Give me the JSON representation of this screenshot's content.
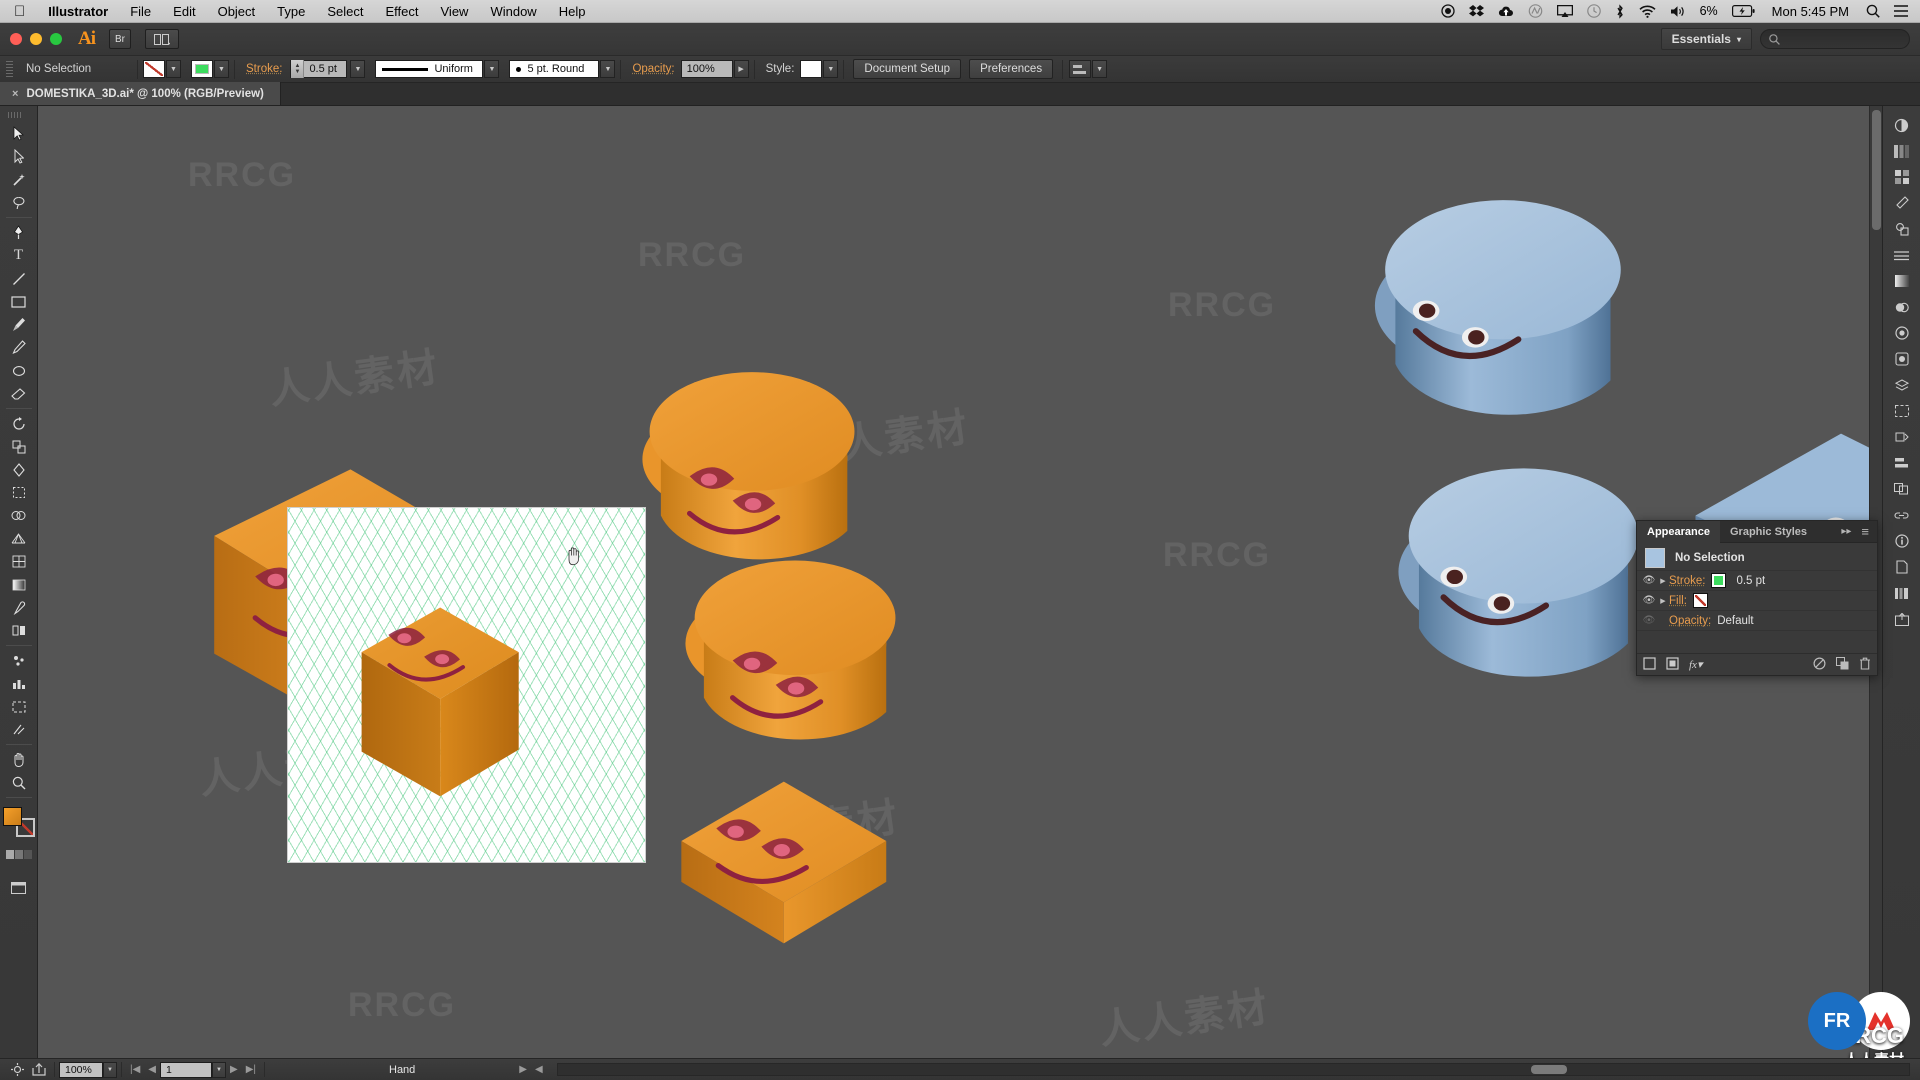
{
  "macmenu": {
    "apple_icon": "apple-icon",
    "items": [
      {
        "label": "Illustrator",
        "bold": true
      },
      {
        "label": "File",
        "bold": false
      },
      {
        "label": "Edit",
        "bold": false
      },
      {
        "label": "Object",
        "bold": false
      },
      {
        "label": "Type",
        "bold": false
      },
      {
        "label": "Select",
        "bold": false
      },
      {
        "label": "Effect",
        "bold": false
      },
      {
        "label": "View",
        "bold": false
      },
      {
        "label": "Window",
        "bold": false
      },
      {
        "label": "Help",
        "bold": false
      }
    ],
    "status_icons": [
      "record-icon",
      "dropbox-icon",
      "cloud-upload-icon",
      "creative-cloud-icon",
      "airplay-icon",
      "clock-icon",
      "bluetooth-icon",
      "wifi-icon",
      "volume-icon"
    ],
    "battery_percent": "6%",
    "battery_icon": "battery-charging-icon",
    "clock": "Mon 5:45 PM",
    "search_icon": "search-icon",
    "notification_icon": "list-icon"
  },
  "appbar": {
    "logo": "Ai",
    "bridge_button": "Br",
    "arrange_button": "arrange-documents-icon",
    "workspace": "Essentials",
    "workspace_caret": "▾",
    "search_placeholder": "",
    "search_icon": "search-icon"
  },
  "control_bar": {
    "selection_status": "No Selection",
    "fill_swatch": "none",
    "stroke_swatch": "green",
    "stroke_label": "Stroke:",
    "stroke_weight": "0.5 pt",
    "profile_label": "Uniform",
    "brush_label": "5 pt. Round",
    "opacity_label": "Opacity:",
    "opacity_value": "100%",
    "style_label": "Style:",
    "document_setup": "Document Setup",
    "preferences": "Preferences",
    "align_icon": "align-icon"
  },
  "document_tab": {
    "close_icon": "×",
    "title": "DOMESTIKA_3D.ai* @ 100% (RGB/Preview)"
  },
  "toolbar": {
    "tools": [
      {
        "name": "selection-tool",
        "glyph": "▲"
      },
      {
        "name": "direct-selection-tool",
        "glyph": "◣"
      },
      {
        "name": "magic-wand-tool",
        "glyph": "✦"
      },
      {
        "name": "lasso-tool",
        "glyph": "◠"
      },
      {
        "name": "pen-tool",
        "glyph": "✒"
      },
      {
        "name": "type-tool",
        "glyph": "T"
      },
      {
        "name": "line-segment-tool",
        "glyph": "╲"
      },
      {
        "name": "rectangle-tool",
        "glyph": "▭"
      },
      {
        "name": "paintbrush-tool",
        "glyph": "🖌"
      },
      {
        "name": "pencil-tool",
        "glyph": "✎"
      },
      {
        "name": "blob-brush-tool",
        "glyph": "◉"
      },
      {
        "name": "eraser-tool",
        "glyph": "▱"
      },
      {
        "name": "rotate-tool",
        "glyph": "↻"
      },
      {
        "name": "scale-tool",
        "glyph": "⤢"
      },
      {
        "name": "width-tool",
        "glyph": "◇"
      },
      {
        "name": "free-transform-tool",
        "glyph": "⬚"
      },
      {
        "name": "shape-builder-tool",
        "glyph": "⬡"
      },
      {
        "name": "perspective-grid-tool",
        "glyph": "▦"
      },
      {
        "name": "mesh-tool",
        "glyph": "▩"
      },
      {
        "name": "gradient-tool",
        "glyph": "▤"
      },
      {
        "name": "eyedropper-tool",
        "glyph": "⚲"
      },
      {
        "name": "blend-tool",
        "glyph": "❏"
      },
      {
        "name": "symbol-sprayer-tool",
        "glyph": "❁"
      },
      {
        "name": "column-graph-tool",
        "glyph": "▥"
      },
      {
        "name": "artboard-tool",
        "glyph": "⬓"
      },
      {
        "name": "slice-tool",
        "glyph": "✂"
      },
      {
        "name": "hand-tool",
        "glyph": "✋"
      },
      {
        "name": "zoom-tool",
        "glyph": "🔍"
      }
    ],
    "fill_stroke_name": "fill-and-stroke-swatches",
    "screen_mode_name": "screen-mode-button"
  },
  "right_dock": {
    "icons": [
      "color-panel-icon",
      "color-guide-icon",
      "swatches-panel-icon",
      "brushes-panel-icon",
      "symbols-panel-icon",
      "stroke-panel-icon",
      "gradient-panel-icon",
      "transparency-icon",
      "appearance-panel-icon",
      "graphic-styles-icon",
      "layers-panel-icon",
      "artboards-icon",
      "transform-panel-icon",
      "align-panel-icon",
      "pathfinder-icon",
      "links-panel-icon",
      "info-panel-icon",
      "document-info-icon",
      "libraries-icon",
      "asset-export-icon"
    ]
  },
  "appearance_panel": {
    "tabs": [
      {
        "label": "Appearance",
        "active": true
      },
      {
        "label": "Graphic Styles",
        "active": false
      }
    ],
    "collapse_icon": "▸▸",
    "menu_icon": "≡",
    "selection_row": "No Selection",
    "rows": [
      {
        "label": "Stroke:",
        "value": "0.5 pt",
        "swatch": "green",
        "eye": true,
        "has_triangle": true
      },
      {
        "label": "Fill:",
        "value": "",
        "swatch": "none",
        "eye": true,
        "has_triangle": true
      },
      {
        "label": "Opacity:",
        "value": "Default",
        "swatch": "",
        "eye": false,
        "has_triangle": false
      }
    ],
    "footer_icons": [
      "add-new-stroke-icon",
      "add-new-fill-icon",
      "add-new-effect-icon",
      "clear-appearance-icon",
      "duplicate-item-icon",
      "delete-item-icon"
    ]
  },
  "status_bar": {
    "settings_icon": "gear-icon",
    "share_icon": "share-icon",
    "zoom_level": "100%",
    "page_number": "1",
    "current_tool": "Hand",
    "nav_first": "|◀",
    "nav_prev": "◀",
    "nav_next": "▶",
    "nav_last": "▶|"
  },
  "canvas": {
    "background_color": "#555555",
    "artboard_color": "#ffffff",
    "grid_color": "#50c882",
    "cursor": "hand-cursor",
    "shapes": [
      {
        "name": "orange-cube-left",
        "type": "cube",
        "color": "#e2912d"
      },
      {
        "name": "orange-cylinder-top",
        "type": "cylinder",
        "color": "#e2912d"
      },
      {
        "name": "orange-cylinder-mid",
        "type": "cylinder",
        "color": "#e2912d"
      },
      {
        "name": "orange-slab",
        "type": "slab",
        "color": "#e2912d"
      },
      {
        "name": "orange-cube-artboard",
        "type": "cube",
        "color": "#d4861f"
      },
      {
        "name": "blue-cylinder-top",
        "type": "cylinder",
        "color": "#9dbbd8"
      },
      {
        "name": "blue-cylinder-mid",
        "type": "cylinder",
        "color": "#9dbbd8"
      },
      {
        "name": "blue-shape-right",
        "type": "cube",
        "color": "#9dbbd8"
      }
    ]
  },
  "watermarks": {
    "cn": "人人素材",
    "en": "RRCG",
    "badge_rr": "FR",
    "badge_brand": "RRCG",
    "badge_sub": "人人素材"
  }
}
